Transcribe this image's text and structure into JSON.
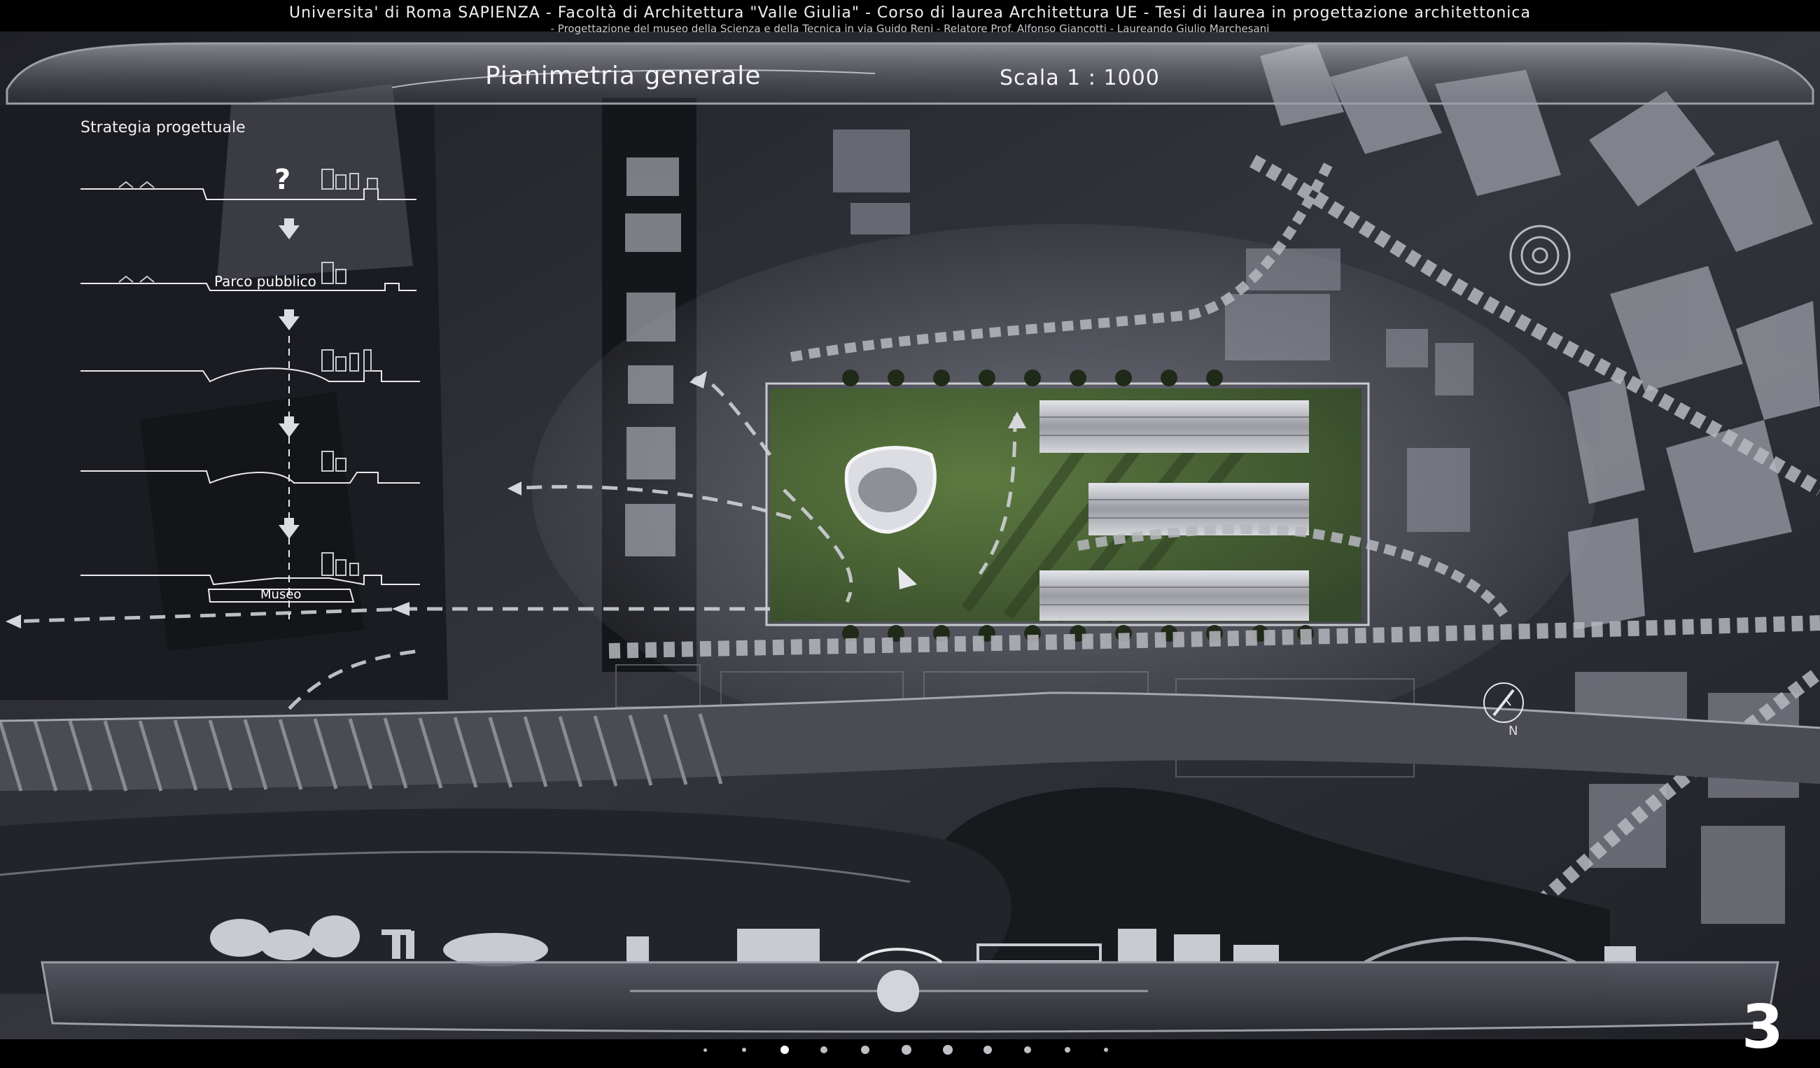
{
  "header": {
    "line1": "Universita' di Roma SAPIENZA  -  Facoltà di Architettura  \"Valle Giulia\"  -  Corso di laurea  Architettura UE  -  Tesi di laurea in progettazione architettonica",
    "line2": "-  Progettazione del museo della Scienza e della Tecnica in via Guido Reni - Relatore Prof. Alfonso Giancotti  -  Laureando Giulio Marchesani"
  },
  "title_bar": {
    "title": "Pianimetria generale",
    "scale": "Scala 1 : 1000"
  },
  "strategy_panel": {
    "heading": "Strategia progettuale",
    "question_mark": "?",
    "step_park_label": "Parco pubblico",
    "step_museum_label": "Museo"
  },
  "compass": {
    "label": "N"
  },
  "page_number": "3",
  "pagination": {
    "total": 11,
    "active_index": 2
  },
  "colors": {
    "background": "#000000",
    "map_dark": "#2b2c33",
    "park_green": "#4f6a36",
    "dashed_path": "#c8c9d0",
    "frame_glass": "#8d8f99"
  }
}
